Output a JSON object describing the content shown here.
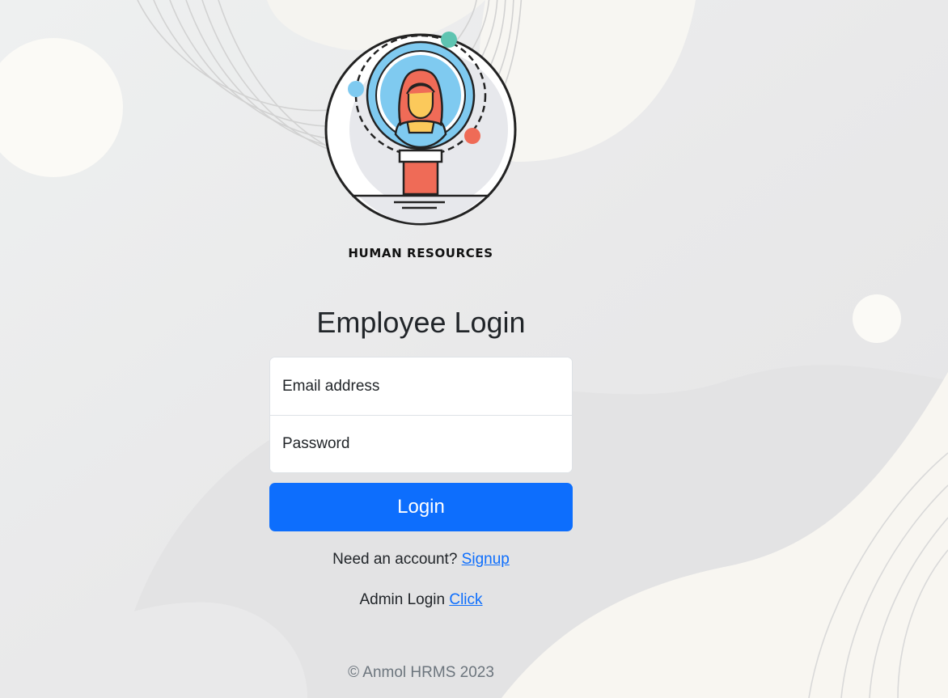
{
  "brand": {
    "caption": "HUMAN RESOURCES",
    "logo_icon": "hr-employee-magnifier-icon"
  },
  "form": {
    "heading": "Employee Login",
    "email_placeholder": "Email address",
    "password_placeholder": "Password",
    "login_label": "Login"
  },
  "links": {
    "signup_prompt": "Need an account?",
    "signup_label": "Signup",
    "admin_prompt": "Admin Login",
    "admin_label": "Click"
  },
  "footer": {
    "copyright": "© Anmol HRMS 2023"
  },
  "colors": {
    "primary": "#0d6efd",
    "background": "#ececec",
    "accent_teal": "#5ec4b1",
    "accent_red": "#ef6b57",
    "accent_blue": "#7fcaf0",
    "skin": "#fbc95b"
  }
}
